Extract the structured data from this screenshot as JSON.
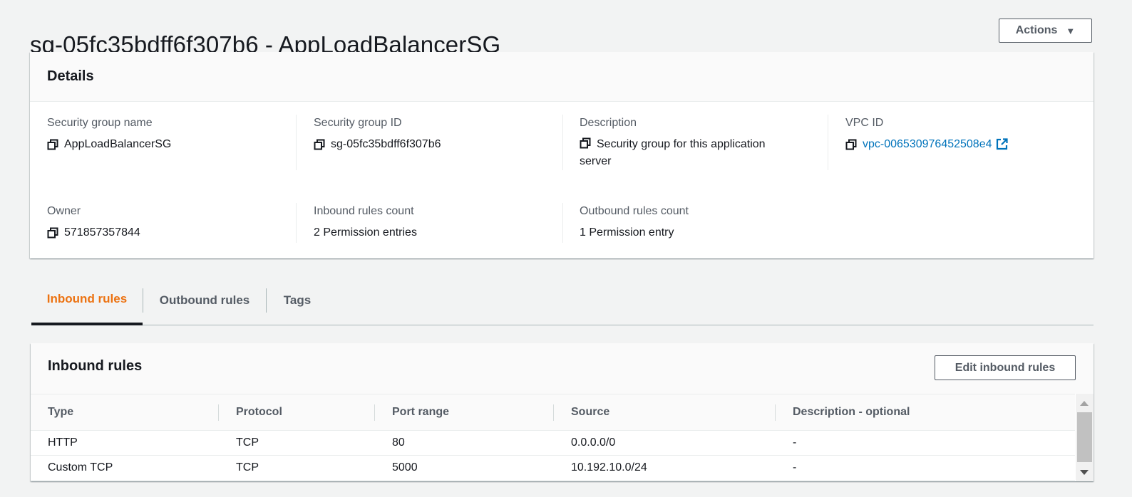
{
  "page": {
    "title": "sg-05fc35bdff6f307b6 - AppLoadBalancerSG",
    "actions_label": "Actions",
    "actions_caret": "▼"
  },
  "details": {
    "heading": "Details",
    "fields": {
      "sg_name": {
        "label": "Security group name",
        "value": "AppLoadBalancerSG"
      },
      "sg_id": {
        "label": "Security group ID",
        "value": "sg-05fc35bdff6f307b6"
      },
      "description": {
        "label": "Description",
        "value": "Security group for this application server"
      },
      "vpc_id": {
        "label": "VPC ID",
        "value": "vpc-006530976452508e4"
      },
      "owner": {
        "label": "Owner",
        "value": "571857357844"
      },
      "inbound_count": {
        "label": "Inbound rules count",
        "value": "2 Permission entries"
      },
      "outbound_count": {
        "label": "Outbound rules count",
        "value": "1 Permission entry"
      }
    }
  },
  "tabs": [
    {
      "label": "Inbound rules",
      "active": true
    },
    {
      "label": "Outbound rules",
      "active": false
    },
    {
      "label": "Tags",
      "active": false
    }
  ],
  "inbound": {
    "heading": "Inbound rules",
    "edit_label": "Edit inbound rules",
    "columns": [
      "Type",
      "Protocol",
      "Port range",
      "Source",
      "Description - optional"
    ],
    "rows": [
      [
        "HTTP",
        "TCP",
        "80",
        "0.0.0.0/0",
        "-"
      ],
      [
        "Custom TCP",
        "TCP",
        "5000",
        "10.192.10.0/24",
        "-"
      ]
    ]
  },
  "colors": {
    "accent_tab": "#ec7211",
    "link": "#0073bb",
    "text": "#16191f",
    "secondary_text": "#545b64"
  }
}
